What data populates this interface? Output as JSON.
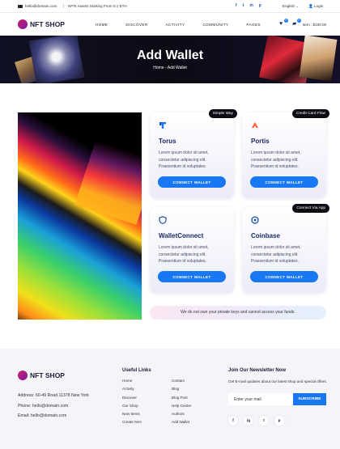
{
  "topbar": {
    "email": "hello@domain.com",
    "announcement": "NFTs Assets Starting From 0.1 ETH",
    "socials": [
      "f",
      "t",
      "in",
      "p"
    ],
    "language": "English",
    "login": "Login"
  },
  "header": {
    "logo_text": "NFT SHOP",
    "nav": [
      "HOME",
      "DISCOVER",
      "ACTIVITY",
      "COMMUNITY",
      "PAGES"
    ],
    "wishlist_count": "0",
    "cart_count": "0",
    "item_label": "item : $100.00"
  },
  "banner": {
    "title": "Add Wallet",
    "breadcrumb_home": "Home",
    "breadcrumb_sep": " - ",
    "breadcrumb_current": "Add Wallet"
  },
  "wallets": [
    {
      "name": "Torus",
      "tag": "Simple Way",
      "desc": "Lorem ipsum dolor sit amet, consectetur adipiscing elit. Praesentium id voluptates.",
      "button": "CONNECT WALLET",
      "icon": "torus-icon"
    },
    {
      "name": "Portis",
      "tag": "Credit Card Flow",
      "desc": "Lorem ipsum dolor sit amet, consectetur adipiscing elit. Praesentium id voluptates.",
      "button": "CONNECT WALLET",
      "icon": "portis-icon"
    },
    {
      "name": "WalletConnect",
      "tag": "",
      "desc": "Lorem ipsum dolor sit amet, consectetur adipiscing elit. Praesentium id voluptates.",
      "button": "CONNECT WALLET",
      "icon": "shield-icon"
    },
    {
      "name": "Coinbase",
      "tag": "Connect Via App",
      "desc": "Lorem ipsum dolor sit amet, consectetur adipiscing elit. Praesentium id voluptates.",
      "button": "CONNECT WALLET",
      "icon": "coinbase-icon"
    }
  ],
  "notice": "We do not own your private keys and cannot access your funds.",
  "footer": {
    "logo_text": "NFT SHOP",
    "address": "Address: 60-49 Road 11378 New York",
    "phone": "Phone: hello@domain.com",
    "email": "Email: hello@domain.com",
    "links_title": "Useful Links",
    "links_col1": [
      "Home",
      "Activity",
      "Discover",
      "Our Shop",
      "New Items",
      "Create Item"
    ],
    "links_col2": [
      "Contact",
      "Blog",
      "Blog Post",
      "Help Center",
      "Authors",
      "Add Wallet"
    ],
    "newsletter_title": "Join Our Newsletter Now",
    "newsletter_text": "Get E-mail updates about our latest shop and special offers.",
    "email_placeholder": "Enter your mail",
    "subscribe": "SUBSCRIBE",
    "socials": [
      "f",
      "ig",
      "t",
      "p"
    ]
  },
  "colors": {
    "accent": "#1877f2",
    "navy": "#1b2a66",
    "brand": "#d11f6e"
  }
}
